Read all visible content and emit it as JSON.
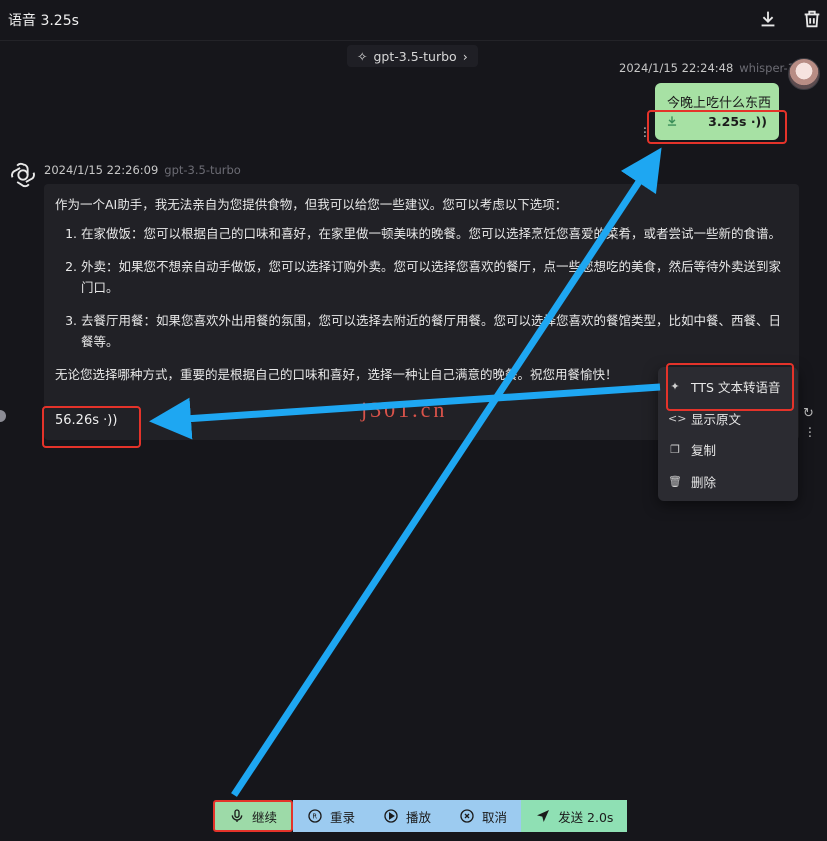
{
  "header": {
    "title": "语音 3.25s",
    "download_icon": "download-icon",
    "trash_icon": "trash-icon"
  },
  "model_chip": {
    "label": "gpt-3.5-turbo"
  },
  "user_message": {
    "timestamp": "2024/1/15 22:24:48",
    "model": "whisper-1",
    "text": "今晚上吃什么东西",
    "duration": "3.25s"
  },
  "bot_message": {
    "timestamp": "2024/1/15 22:26:09",
    "model": "gpt-3.5-turbo",
    "intro": "作为一个AI助手，我无法亲自为您提供食物，但我可以给您一些建议。您可以考虑以下选项：",
    "items": [
      "在家做饭：您可以根据自己的口味和喜好，在家里做一顿美味的晚餐。您可以选择烹饪您喜爱的菜肴，或者尝试一些新的食谱。",
      "外卖：如果您不想亲自动手做饭，您可以选择订购外卖。您可以选择您喜欢的餐厅，点一些您想吃的美食，然后等待外卖送到家门口。",
      "去餐厅用餐：如果您喜欢外出用餐的氛围，您可以选择去附近的餐厅用餐。您可以选择您喜欢的餐馆类型，比如中餐、西餐、日餐等。"
    ],
    "outro": "无论您选择哪种方式，重要的是根据自己的口味和喜好，选择一种让自己满意的晚餐。祝您用餐愉快！",
    "duration": "56.26s"
  },
  "context_menu": {
    "items": [
      {
        "label": "TTS 文本转语音",
        "icon": "tts-icon"
      },
      {
        "label": "显示原文",
        "icon": "code-icon"
      },
      {
        "label": "复制",
        "icon": "copy-icon"
      },
      {
        "label": "删除",
        "icon": "trash-icon"
      }
    ]
  },
  "watermark": "j301.cn",
  "bottom_bar": {
    "continue": "继续",
    "rerecord": "重录",
    "play": "播放",
    "cancel": "取消",
    "send": "发送 2.0s"
  },
  "colors": {
    "background": "#16161b",
    "user_bubble": "#a7e1a4",
    "reply_box": "#212126",
    "annotation_red": "#e4332a",
    "annotation_arrow": "#1ea7f2",
    "button_blue": "#9ccbf0",
    "button_green": "#9ddaa8"
  }
}
